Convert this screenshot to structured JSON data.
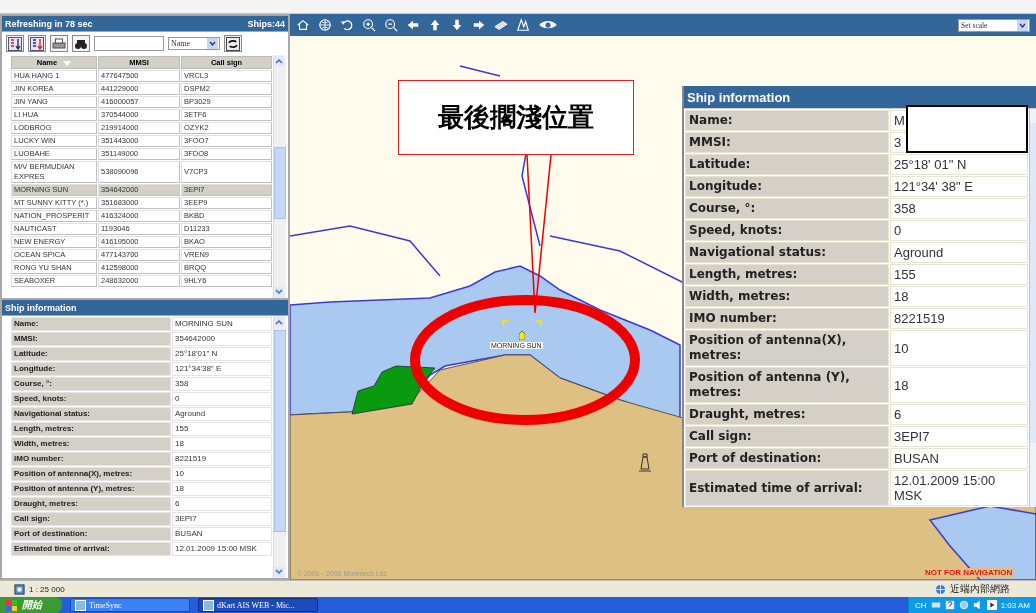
{
  "ship_list": {
    "title": "Refreshing in 78 sec",
    "count": "Ships:44",
    "sort_field": "Name",
    "columns": [
      "Name",
      "MMSI",
      "Call sign"
    ],
    "rows": [
      {
        "name": "HUA HANG 1",
        "mmsi": "477647500",
        "call_sign": "VRCL3",
        "selected": false
      },
      {
        "name": "JIN KOREA",
        "mmsi": "441229000",
        "call_sign": "DSPM2",
        "selected": false
      },
      {
        "name": "JIN YANG",
        "mmsi": "416000057",
        "call_sign": "BP3029",
        "selected": false
      },
      {
        "name": "LI HUA",
        "mmsi": "370544000",
        "call_sign": "3ETF6",
        "selected": false
      },
      {
        "name": "LODBROG",
        "mmsi": "219914000",
        "call_sign": "OZYK2",
        "selected": false
      },
      {
        "name": "LUCKY WIN",
        "mmsi": "351443000",
        "call_sign": "3FOO7",
        "selected": false
      },
      {
        "name": "LUOBAHE",
        "mmsi": "351149000",
        "call_sign": "3FDO8",
        "selected": false
      },
      {
        "name": "M/V BERMUDIAN EXPRES",
        "mmsi": "538090096",
        "call_sign": "V7CP3",
        "selected": false
      },
      {
        "name": "MORNING SUN",
        "mmsi": "354642000",
        "call_sign": "3EPI7",
        "selected": true
      },
      {
        "name": "MT SUNNY KITTY (*.)",
        "mmsi": "351683000",
        "call_sign": "3EEP9",
        "selected": false
      },
      {
        "name": "NATION_PROSPERIT",
        "mmsi": "416324000",
        "call_sign": "BKBD",
        "selected": false
      },
      {
        "name": "NAUTICAST",
        "mmsi": "1193046",
        "call_sign": "D11233",
        "selected": false
      },
      {
        "name": "NEW ENERGY",
        "mmsi": "416195000",
        "call_sign": "BKAO",
        "selected": false
      },
      {
        "name": "OCEAN SPICA",
        "mmsi": "477143700",
        "call_sign": "VREN9",
        "selected": false
      },
      {
        "name": "RONG YU SHAN",
        "mmsi": "412598000",
        "call_sign": "BRQQ",
        "selected": false
      },
      {
        "name": "SEABOXER",
        "mmsi": "248632000",
        "call_sign": "9HLY6",
        "selected": false
      }
    ]
  },
  "ship_info": {
    "title": "Ship information",
    "rows": [
      {
        "label": "Name:",
        "value": "MORNING SUN"
      },
      {
        "label": "MMSI:",
        "value": "354642000"
      },
      {
        "label": "Latitude:",
        "value": "25°18'01\" N"
      },
      {
        "label": "Longitude:",
        "value": "121°34'38\" E"
      },
      {
        "label": "Course, °:",
        "value": "358"
      },
      {
        "label": "Speed, knots:",
        "value": "0"
      },
      {
        "label": "Navigational status:",
        "value": "Aground"
      },
      {
        "label": "Length, metres:",
        "value": "155"
      },
      {
        "label": "Width, metres:",
        "value": "18"
      },
      {
        "label": "IMO number:",
        "value": "8221519"
      },
      {
        "label": "Position of antenna(X), metres:",
        "value": "10"
      },
      {
        "label": "Position of antenna (Y), metres:",
        "value": "18"
      },
      {
        "label": "Draught, metres:",
        "value": "6"
      },
      {
        "label": "Call sign:",
        "value": "3EPI7"
      },
      {
        "label": "Port of destination:",
        "value": "BUSAN"
      },
      {
        "label": "Estimated time of arrival:",
        "value": "12.01.2009 15:00 MSK"
      }
    ]
  },
  "map": {
    "scale_select": "Set scale",
    "ship_label": "MORNING SUN",
    "callout": "最後擱淺位置",
    "copyright": "© 2001 - 2006 Morintech Ltd.",
    "warning": "NOT FOR NAVIGATION"
  },
  "overlay_info": {
    "title": "Ship information",
    "rows": [
      {
        "label": "Name:",
        "value": "M"
      },
      {
        "label": "MMSI:",
        "value": "3"
      },
      {
        "label": "Latitude:",
        "value": "25°18' 01\" N"
      },
      {
        "label": "Longitude:",
        "value": "121°34' 38\" E"
      },
      {
        "label": "Course, °:",
        "value": "358"
      },
      {
        "label": "Speed, knots:",
        "value": "0"
      },
      {
        "label": "Navigational status:",
        "value": "Aground"
      },
      {
        "label": "Length, metres:",
        "value": "155"
      },
      {
        "label": "Width, metres:",
        "value": "18"
      },
      {
        "label": "IMO number:",
        "value": "8221519"
      },
      {
        "label": "Position of antenna(X), metres:",
        "value": "10"
      },
      {
        "label": "Position of antenna (Y), metres:",
        "value": "18"
      },
      {
        "label": "Draught, metres:",
        "value": "6"
      },
      {
        "label": "Call sign:",
        "value": "3EPI7"
      },
      {
        "label": "Port of destination:",
        "value": "BUSAN"
      },
      {
        "label": "Estimated time of arrival:",
        "value": "12.01.2009 15:00 MSK"
      }
    ]
  },
  "status_bar": {
    "scale": "1 : 25 000",
    "zone": "近端內部網路"
  },
  "taskbar": {
    "start": "開始",
    "windows": [
      {
        "label": "TimeSync",
        "selected": false
      },
      {
        "label": "dKart AIS WEB - Mic...",
        "selected": true
      }
    ],
    "language": "CH",
    "clock": "1:03 AM"
  }
}
